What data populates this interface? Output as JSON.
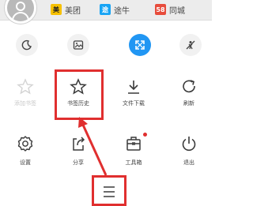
{
  "top_sites": [
    {
      "name": "美团",
      "badge": "美"
    },
    {
      "name": "途牛",
      "badge": "途"
    },
    {
      "name": "同城",
      "badge": "58"
    }
  ],
  "menu": {
    "add_bookmark": "添加书签",
    "bookmarks_history": "书签历史",
    "downloads": "文件下载",
    "refresh": "刷新",
    "settings": "设置",
    "share": "分享",
    "toolbox": "工具箱",
    "exit": "退出"
  },
  "colors": {
    "annotation": "#e02f2f",
    "accent": "#2196f3"
  }
}
